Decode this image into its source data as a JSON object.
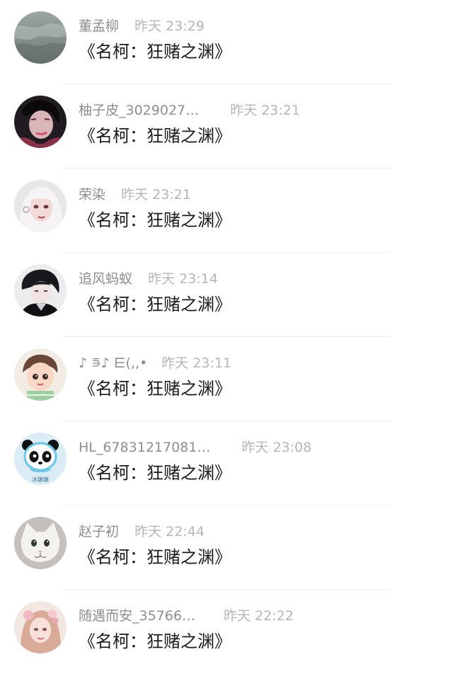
{
  "comments": [
    {
      "name": "董孟柳",
      "time": "昨天 23:29",
      "text": "《名柯：狂赌之渊》",
      "avatar": "lake-avatar-icon"
    },
    {
      "name": "柚子皮_3029027…",
      "time": "昨天 23:21",
      "text": "《名柯：狂赌之渊》",
      "avatar": "dark-portrait-avatar-icon"
    },
    {
      "name": "荣染",
      "time": "昨天 23:21",
      "text": "《名柯：狂赌之渊》",
      "avatar": "anime-girl-avatar-icon"
    },
    {
      "name": "追风蚂蚁",
      "time": "昨天 23:14",
      "text": "《名柯：狂赌之渊》",
      "avatar": "anime-boy-avatar-icon"
    },
    {
      "name": "♪ ⋾♪ ⋿(,,•",
      "time": "昨天 23:11",
      "text": "《名柯：狂赌之渊》",
      "avatar": "cartoon-child-avatar-icon"
    },
    {
      "name": "HL_67831217081…",
      "time": "昨天 23:08",
      "text": "《名柯：狂赌之渊》",
      "avatar": "panda-mascot-avatar-icon",
      "avatar_caption": "冰墩墩"
    },
    {
      "name": "赵子初",
      "time": "昨天 22:44",
      "text": "《名柯：狂赌之渊》",
      "avatar": "white-cat-avatar-icon"
    },
    {
      "name": "随遇而安_35766…",
      "time": "昨天 22:22",
      "text": "《名柯：狂赌之渊》",
      "avatar": "floral-girl-avatar-icon"
    }
  ],
  "colors": {
    "name": "#8e8e8e",
    "time": "#b6b6b6",
    "text": "#1b1b1b",
    "divider": "#efefef",
    "background": "#ffffff"
  }
}
